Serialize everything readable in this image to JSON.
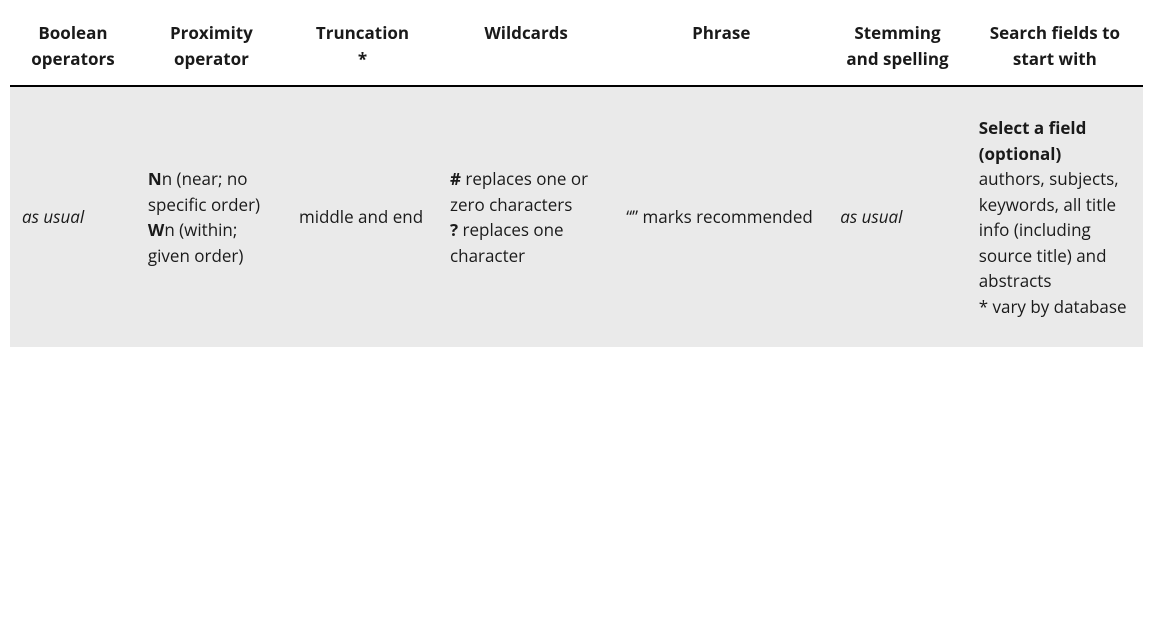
{
  "table": {
    "headers": {
      "boolean": "Boolean operators",
      "proximity": "Proximity operator",
      "truncation_line1": "Truncation",
      "truncation_line2": "*",
      "wildcards": "Wildcards",
      "phrase": "Phrase",
      "stemming": "Stemming and spelling",
      "fields": "Search fields to start with"
    },
    "row": {
      "boolean": "as usual",
      "proximity": {
        "p1_bold": "N",
        "p1_rest": "n (near; no specific order)",
        "p2_bold": "W",
        "p2_rest": "n (within; given order)"
      },
      "truncation": "middle and end",
      "wildcards": {
        "p1_bold": "#",
        "p1_rest": " replaces one or zero characters",
        "p2_bold": "?",
        "p2_rest": " replaces one character"
      },
      "phrase": "“” marks recommended",
      "stemming": "as usual",
      "fields": {
        "heading": "Select a field (optional)",
        "body": "authors, subjects, keywords, all title info (including source title) and abstracts",
        "note": "* vary by database"
      }
    }
  }
}
